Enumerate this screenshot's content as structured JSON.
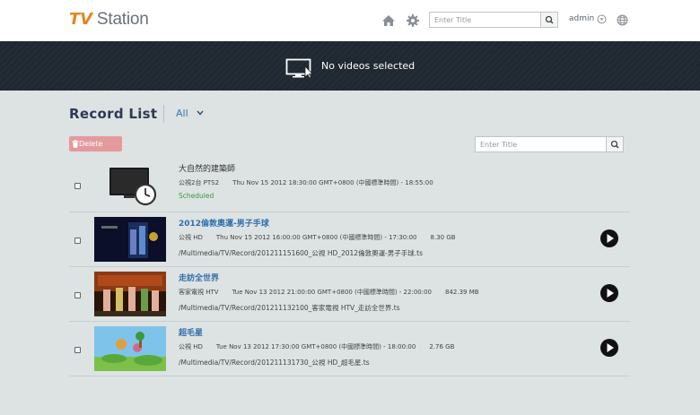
{
  "header": {
    "logo_tv": "TV",
    "logo_station": " Station",
    "search_placeholder": "Enter Title",
    "user": "admin"
  },
  "banner": {
    "text": "No videos selected"
  },
  "list": {
    "title": "Record List",
    "filter": "All",
    "delete_label": "Delete",
    "search_placeholder": "Enter Title"
  },
  "records": [
    {
      "title": "大自然的建築師",
      "channel": "公視2台 PTS2",
      "time": "Thu Nov 15 2012 18:30:00 GMT+0800 (中國標準時間) - 18:55:00",
      "size": "",
      "path": "",
      "status": "Scheduled"
    },
    {
      "title": "2012倫敦奧運-男子手球",
      "channel": "公視 HD",
      "time": "Thu Nov 15 2012 16:00:00 GMT+0800 (中國標準時間) - 17:30:00",
      "size": "8.30 GB",
      "path": "/Multimedia/TV/Record/201211151600_公視 HD_2012倫敦奧運-男子手球.ts",
      "status": ""
    },
    {
      "title": "走訪全世界",
      "channel": "客家電視 HTV",
      "time": "Tue Nov 13 2012 21:00:00 GMT+0800 (中國標準時間) - 22:00:00",
      "size": "842.39 MB",
      "path": "/Multimedia/TV/Record/201211132100_客家電視 HTV_走訪全世界.ts",
      "status": ""
    },
    {
      "title": "超毛星",
      "channel": "公視 HD",
      "time": "Tue Nov 13 2012 17:30:00 GMT+0800 (中國標準時間) - 18:00:00",
      "size": "2.76 GB",
      "path": "/Multimedia/TV/Record/201211131730_公視 HD_超毛星.ts",
      "status": ""
    }
  ],
  "colors": {
    "accent": "#e8841a",
    "link": "#2f6fad",
    "banner": "#1f2830",
    "status": "#3a9a3a"
  }
}
